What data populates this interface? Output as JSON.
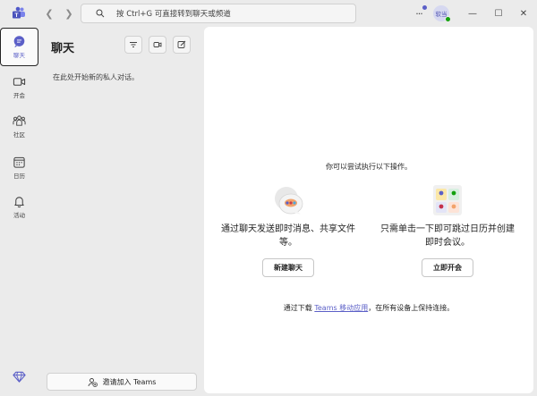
{
  "titlebar": {
    "search_placeholder": "按 Ctrl+G 可直接转到聊天或频道",
    "more_symbol": "···",
    "avatar_initials": "软当",
    "window_min": "—",
    "window_max": "☐",
    "window_close": "✕"
  },
  "rail": {
    "chat": "聊天",
    "meet": "开会",
    "community": "社区",
    "calendar": "日历",
    "activity": "活动"
  },
  "chat_pane": {
    "title": "聊天",
    "empty_hint": "在此处开始新的私人对话。",
    "invite_button": "邀请加入 Teams"
  },
  "main": {
    "prompt": "你可以尝试执行以下操作。",
    "chat_feature": {
      "description": "通过聊天发送即时消息、共享文件等。",
      "button": "新建聊天"
    },
    "meet_feature": {
      "description": "只需单击一下即可跳过日历并创建即时会议。",
      "button": "立即开会"
    },
    "download": {
      "prefix": "通过下载 ",
      "link": "Teams 移动应用",
      "suffix": "，在所有设备上保持连接。"
    }
  },
  "colors": {
    "accent": "#5b5fc7",
    "rail_bg": "#ebebeb",
    "panel_bg": "#ffffff",
    "status_available": "#13a10e"
  }
}
